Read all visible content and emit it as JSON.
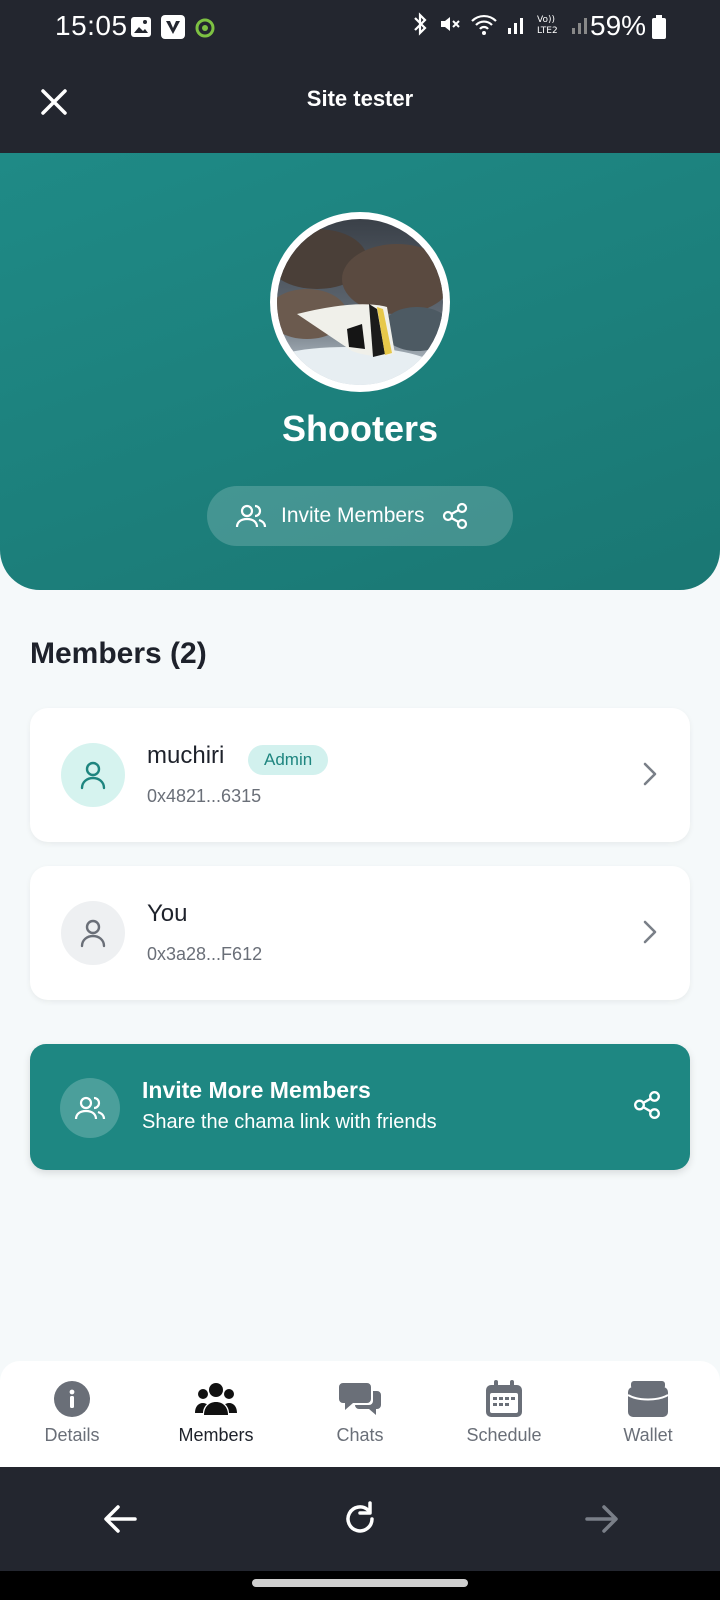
{
  "status_bar": {
    "time": "15:05",
    "battery": "59%"
  },
  "app_bar": {
    "title": "Site tester"
  },
  "group": {
    "name": "Shooters",
    "invite_label": "Invite Members"
  },
  "members": {
    "heading": "Members (2)",
    "items": [
      {
        "name": "muchiri",
        "badge": "Admin",
        "address": "0x4821...6315"
      },
      {
        "name": "You",
        "badge": "",
        "address": "0x3a28...F612"
      }
    ]
  },
  "invite_banner": {
    "title": "Invite More Members",
    "subtitle": "Share the chama link with friends"
  },
  "bottom_nav": {
    "items": [
      {
        "label": "Details",
        "icon": "info-icon"
      },
      {
        "label": "Members",
        "icon": "users-icon"
      },
      {
        "label": "Chats",
        "icon": "chat-icon"
      },
      {
        "label": "Schedule",
        "icon": "calendar-icon"
      },
      {
        "label": "Wallet",
        "icon": "wallet-icon"
      }
    ],
    "active": "Members"
  },
  "colors": {
    "accent": "#1e8782",
    "dark_bar": "#23262f",
    "admin_badge_bg": "#d2f1ee"
  }
}
